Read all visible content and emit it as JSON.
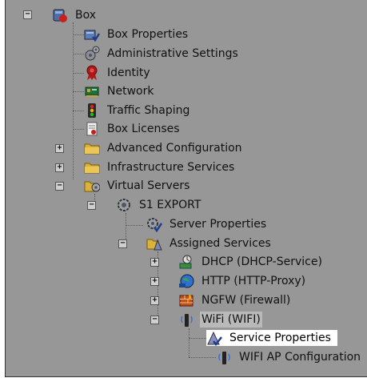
{
  "tree": {
    "box": {
      "label": "Box",
      "icon": "box-server-icon",
      "toggle": "−"
    },
    "box_children": [
      {
        "label": "Box Properties",
        "icon": "box-properties-icon"
      },
      {
        "label": "Administrative Settings",
        "icon": "gears-icon"
      },
      {
        "label": "Identity",
        "icon": "ribbon-award-icon"
      },
      {
        "label": "Network",
        "icon": "network-card-icon"
      },
      {
        "label": "Traffic Shaping",
        "icon": "traffic-light-icon"
      },
      {
        "label": "Box Licenses",
        "icon": "license-document-icon"
      },
      {
        "label": "Advanced Configuration",
        "icon": "folder-icon",
        "toggle": "+"
      },
      {
        "label": "Infrastructure Services",
        "icon": "folder-icon",
        "toggle": "+"
      },
      {
        "label": "Virtual Servers",
        "icon": "folder-gear-icon",
        "toggle": "−"
      }
    ],
    "server": {
      "label": "S1 EXPORT",
      "icon": "gear-icon",
      "toggle": "−"
    },
    "server_children": [
      {
        "label": "Server Properties",
        "icon": "gear-check-icon"
      },
      {
        "label": "Assigned Services",
        "icon": "folder-services-icon",
        "toggle": "−"
      }
    ],
    "services": [
      {
        "label": "DHCP (DHCP-Service)",
        "icon": "dhcp-icon",
        "toggle": "+"
      },
      {
        "label": "HTTP (HTTP-Proxy)",
        "icon": "globe-icon",
        "toggle": "+"
      },
      {
        "label": "NGFW (Firewall)",
        "icon": "firewall-icon",
        "toggle": "+"
      },
      {
        "label": "WiFi (WIFI)",
        "icon": "wifi-antenna-icon",
        "toggle": "−"
      }
    ],
    "wifi_children": [
      {
        "label": "Service Properties",
        "icon": "service-properties-icon"
      },
      {
        "label": "WIFI AP Configuration",
        "icon": "wifi-antenna-icon"
      }
    ]
  },
  "colors": {
    "panel_background": "#979797",
    "selected_highlight": "#ffffff",
    "hover_highlight": "#b9b9b9"
  }
}
